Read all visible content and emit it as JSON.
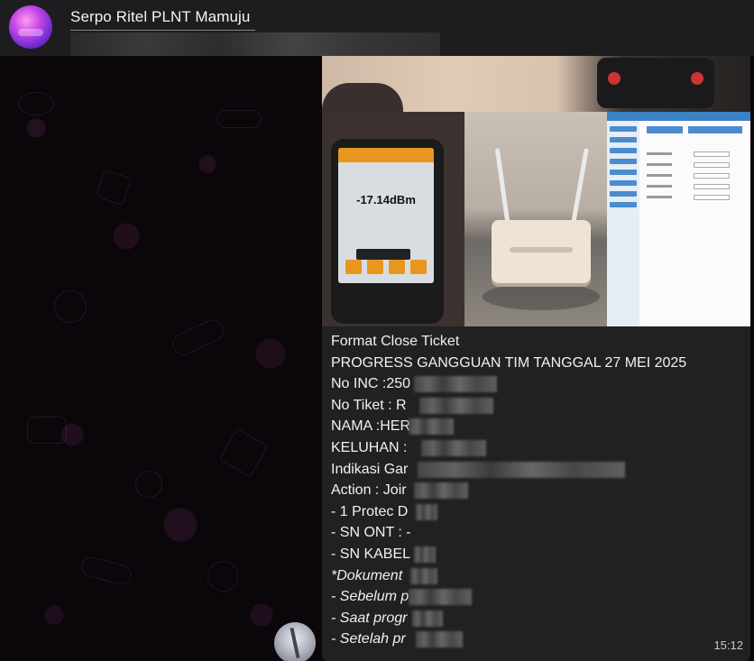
{
  "header": {
    "chat_title": "Serpo Ritel PLNT Mamuju",
    "avatar_icon": "group-avatar-icon"
  },
  "media": {
    "opm_reading": "-17.14dBm"
  },
  "message": {
    "lines": [
      {
        "text": "Format Close Ticket",
        "italic": false
      },
      {
        "text": "PROGRESS GANGGUAN TIM TANGGAL 27 MEI 2025",
        "italic": false
      },
      {
        "text": "No INC :250",
        "italic": false
      },
      {
        "text": "No Tiket : R",
        "italic": false
      },
      {
        "text": "NAMA :HER",
        "italic": false
      },
      {
        "text": "KELUHAN  :",
        "italic": false
      },
      {
        "text": "Indikasi Gar",
        "italic": false
      },
      {
        "text": "Action : Joir",
        "italic": false
      },
      {
        "text": "- 1 Protec D",
        "italic": false
      },
      {
        "text": "- SN ONT : -",
        "italic": false
      },
      {
        "text": "- SN KABEL",
        "italic": false
      },
      {
        "text": "*Dokument",
        "italic": true
      },
      {
        "text": "- Sebelum p",
        "italic": true
      },
      {
        "text": "- Saat progr",
        "italic": true
      },
      {
        "text": "- Setelah pr",
        "italic": true
      }
    ],
    "time": "15:12"
  },
  "colors": {
    "header_bg": "#1d1d1f",
    "bubble_bg": "#212121",
    "chat_bg": "#0b0609"
  }
}
